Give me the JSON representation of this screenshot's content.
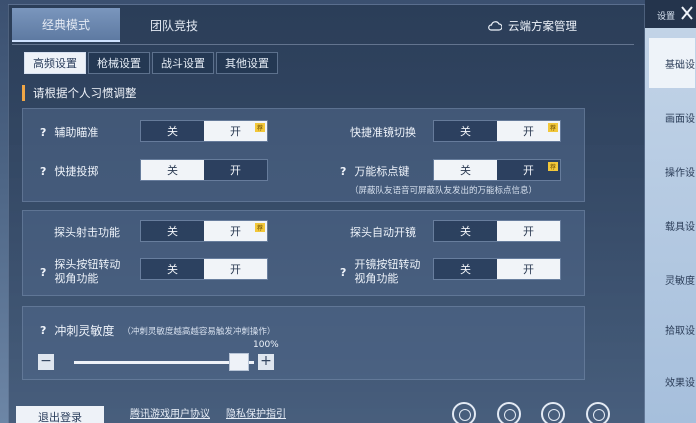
{
  "mode_tabs": [
    "经典模式",
    "团队竞技"
  ],
  "cloud": {
    "label": "云端方案管理"
  },
  "sub_tabs": [
    "高频设置",
    "枪械设置",
    "战斗设置",
    "其他设置"
  ],
  "hint": "请根据个人习惯调整",
  "toggle_labels": {
    "off": "关",
    "on": "开"
  },
  "badge": "荐",
  "settings": {
    "aim_assist": "辅助瞄准",
    "quick_scope_switch": "快捷准镜切换",
    "quick_throw": "快捷投掷",
    "universal_marker": "万能标点键",
    "universal_marker_note": "（屏蔽队友语音可屏蔽队友发出的万能标点信息）",
    "peek_fire": "探头射击功能",
    "peek_auto_scope": "探头自动开镜",
    "peek_button_rotate": [
      "探头按钮转动",
      "视角功能"
    ],
    "scope_button_rotate": [
      "开镜按钮转动",
      "视角功能"
    ],
    "sprint_sensitivity": "冲刺灵敏度",
    "sprint_note": "（冲刺灵敏度越高越容易触发冲刺操作）",
    "sprint_value": "100%"
  },
  "bottom": {
    "logout": "退出登录",
    "user_agreement": "腾讯游戏用户协议",
    "privacy": "隐私保护指引"
  },
  "side": {
    "top_label": "设置",
    "items": [
      "基础设",
      "画面设",
      "操作设",
      "载具设",
      "灵敏度",
      "拾取设",
      "效果设"
    ]
  },
  "colors": {
    "accent": "#f0a646",
    "badge": "#f2c73a"
  }
}
